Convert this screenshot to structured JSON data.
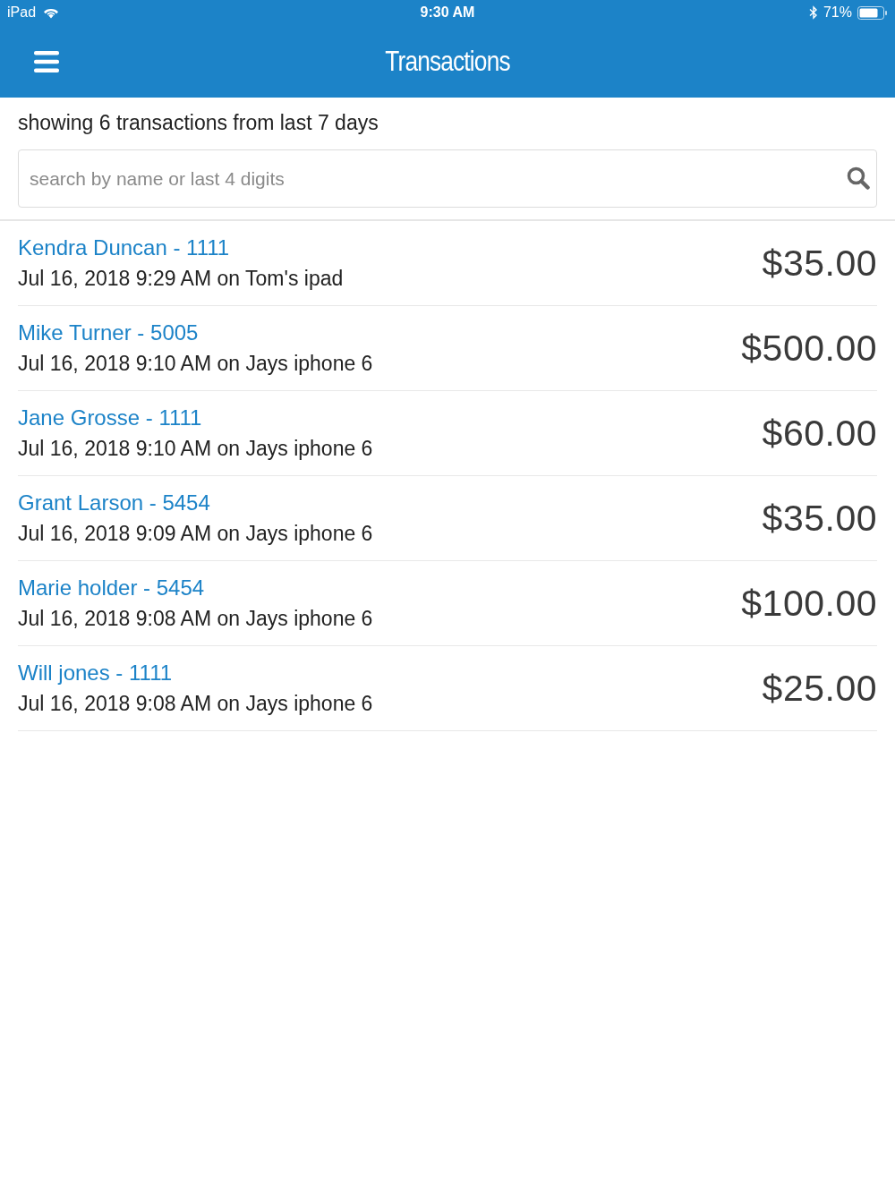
{
  "status_bar": {
    "device": "iPad",
    "time": "9:30 AM",
    "battery": "71%"
  },
  "nav_bar": {
    "title": "Transactions"
  },
  "summary": "showing 6 transactions from last 7 days",
  "search": {
    "placeholder": "search by name or last 4 digits"
  },
  "transactions": [
    {
      "name": "Kendra Duncan - 1111",
      "detail": "Jul 16, 2018 9:29 AM on Tom's ipad",
      "amount": "$35.00"
    },
    {
      "name": "Mike Turner - 5005",
      "detail": "Jul 16, 2018 9:10 AM on Jays iphone 6",
      "amount": "$500.00"
    },
    {
      "name": "Jane Grosse - 1111",
      "detail": "Jul 16, 2018 9:10 AM on Jays iphone 6",
      "amount": "$60.00"
    },
    {
      "name": "Grant Larson - 5454",
      "detail": "Jul 16, 2018 9:09 AM on Jays iphone 6",
      "amount": "$35.00"
    },
    {
      "name": "Marie holder - 5454",
      "detail": "Jul 16, 2018 9:08 AM on Jays iphone 6",
      "amount": "$100.00"
    },
    {
      "name": "Will jones - 1111",
      "detail": "Jul 16, 2018 9:08 AM on Jays iphone 6",
      "amount": "$25.00"
    }
  ]
}
